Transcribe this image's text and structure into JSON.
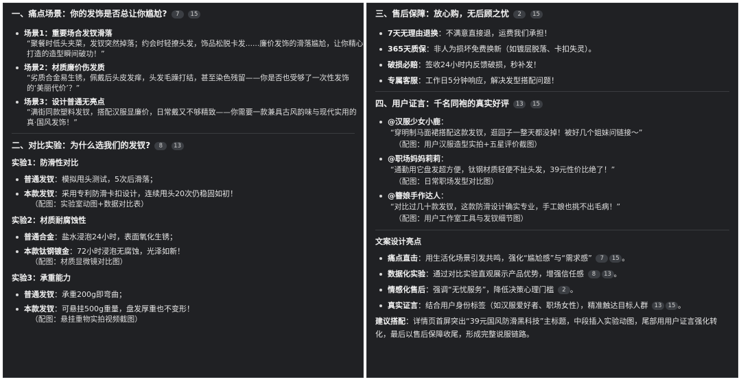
{
  "left": {
    "s1": {
      "title": "一、痛点场景：你的发饰是否总让你尴尬?",
      "badges": [
        "7",
        "15"
      ],
      "items": [
        {
          "head": "场景1：重要场合发钗滑落",
          "lines": [
            "“聚餐时低头夹菜，发钗突然掉落；约会时轻撩头发，饰品松脱卡发......廉价发饰的滑落尴尬，让你精心",
            "打造的造型瞬间破功！”"
          ]
        },
        {
          "head": "场景2：材质廉价伤发质",
          "lines": [
            "“劣质合金易生锈，佩戴后头皮发痒，头发毛躁打结，甚至染色残留——你是否也受够了一次性发饰",
            "的‘美丽代价’？”"
          ]
        },
        {
          "head": "场景3：设计普通无亮点",
          "lines": [
            "“满街同款塑料发钗，搭配汉服显廉价，日常戴又不够精致——你需要一款兼具古风韵味与现代实用的",
            "真·国风发饰！”"
          ]
        }
      ]
    },
    "s2": {
      "title": "二、对比实验：为什么选我们的发钗?",
      "badges": [
        "8",
        "13"
      ],
      "exps": [
        {
          "title": "实验1：防滑性对比",
          "items": [
            {
              "head": "普通发钗",
              "text": "：模拟甩头测试，5次后滑落；"
            },
            {
              "head": "本款发钗",
              "text": "：采用专利防滑卡扣设计，连续甩头20次仍稳固如初！"
            }
          ],
          "note": "（配图：实验室动图+数据对比表）"
        },
        {
          "title": "实验2：材质耐腐蚀性",
          "items": [
            {
              "head": "普通合金",
              "text": "：盐水浸泡24小时，表面氧化生锈；"
            },
            {
              "head": "本款钛钢镀金",
              "text": "：72小时浸泡无腐蚀，光泽如新！"
            }
          ],
          "note": "（配图：材质显微镜对比图）"
        },
        {
          "title": "实验3：承重能力",
          "items": [
            {
              "head": "普通发钗",
              "text": "：承重200g即弯曲；"
            },
            {
              "head": "本款发钗",
              "text": "：可悬挂500g重量，盘发厚重也不变形！"
            }
          ],
          "note": "（配图：悬挂重物实拍视频截图）"
        }
      ]
    }
  },
  "right": {
    "s3": {
      "title": "三、售后保障：放心购，无后顾之忧",
      "badges": [
        "2",
        "15"
      ],
      "items": [
        {
          "head": "7天无理由退换",
          "text": "：不满意直接退，运费我们承担！"
        },
        {
          "head": "365天质保",
          "text": "：非人为损坏免费换新（如镀层脱落、卡扣失灵）。"
        },
        {
          "head": "破损必赔",
          "text": "：签收24小时内反馈破损，秒补发！"
        },
        {
          "head": "专属客服",
          "text": "：工作日5分钟响应，解决发型搭配问题！"
        }
      ]
    },
    "s4": {
      "title": "四、用户证言：千名同袍的真实好评",
      "badges": [
        "13",
        "15"
      ],
      "items": [
        {
          "head": "@汉服少女小鹿",
          "lines": [
            "“穿明制马面裙搭配这款发钗，逛园子一整天都没掉！被好几个姐妹问链接～”",
            "（配图：用户汉服造型实拍+五星评价截图）"
          ]
        },
        {
          "head": "@职场妈妈莉莉",
          "lines": [
            "“通勤用它盘发超方便，钛钢材质轻便不扯头发，39元性价比绝了！”",
            "（配图：日常职场发型对比图）"
          ]
        },
        {
          "head": "@簪娘手作达人",
          "lines": [
            "“对比过几十款发钗，这款防滑设计确实专业，手工娘也挑不出毛病！”",
            "（配图：用户工作室工具与发钗细节图）"
          ]
        }
      ]
    },
    "s5": {
      "title": "文案设计亮点",
      "items": [
        {
          "head": "痛点直击",
          "text": "：用生活化场景引发共鸣，强化“尴尬感”与“需求感”",
          "badges": [
            "7",
            "15"
          ],
          "tail": "。"
        },
        {
          "head": "数据化实验",
          "text": "：通过对比实验直观展示产品优势，增强信任感",
          "badges": [
            "8",
            "13"
          ],
          "tail": "。"
        },
        {
          "head": "情感化售后",
          "text": "：强调“无忧服务”，降低决策心理门槛",
          "badges": [
            "2"
          ],
          "tail": "。"
        },
        {
          "head": "真实证言",
          "text": "：结合用户身份标签（如汉服爱好者、职场女性），精准触达目标人群",
          "badges": [
            "13",
            "15"
          ],
          "tail": "。"
        }
      ],
      "suggest_head": "建议搭配",
      "suggest_line1": "：详情页首屏突出“39元国风防滑黑科技”主标题，中段插入实验动图，尾部用用户证言强化转",
      "suggest_line2": "化，最后以售后保障收尾，形成完整说服链路。"
    }
  }
}
